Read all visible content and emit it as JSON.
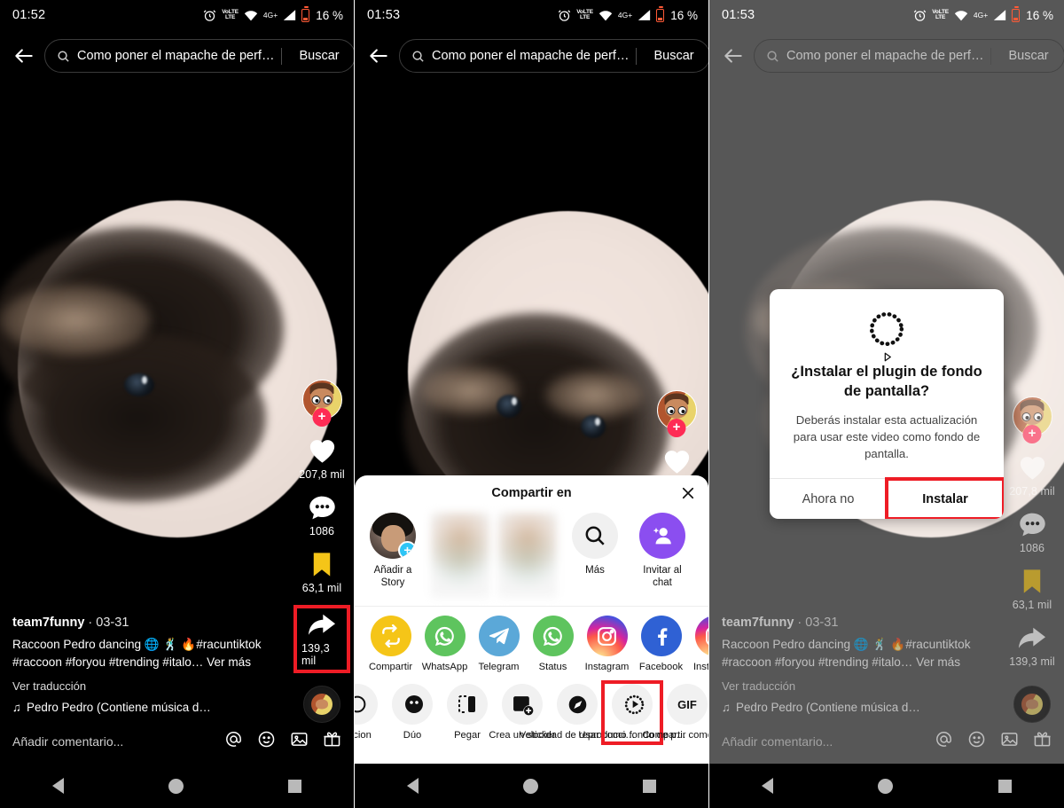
{
  "panels": [
    {
      "id": "panel-1",
      "status": {
        "clock": "01:52",
        "network": "4G+",
        "volte": "VoLTE",
        "battery": "16 %"
      },
      "search": {
        "query": "Como poner el mapache de perf…",
        "button": "Buscar",
        "back_icon": "arrow-left-icon",
        "search_icon": "search-icon"
      },
      "rail": {
        "likes": "207,8 mil",
        "comments": "1086",
        "favorites": "63,1 mil",
        "shares": "139,3 mil",
        "follow_badge": "+"
      },
      "caption": {
        "username": "team7funny",
        "separator": "·",
        "date": "03-31",
        "text": "Raccoon Pedro dancing 🌐 🕺 🔥#racuntiktok #raccoon #foryou #trending #italo…",
        "more": "Ver más",
        "translate": "Ver traducción",
        "music": "Pedro Pedro (Contiene música d…",
        "music_icon": "music-note-icon"
      },
      "comment_bar": {
        "placeholder": "Añadir comentario...",
        "icons": [
          "at-icon",
          "emoji-icon",
          "image-icon",
          "gift-icon"
        ]
      },
      "highlight": "share-button"
    },
    {
      "id": "panel-2",
      "status": {
        "clock": "01:53",
        "network": "4G+",
        "volte": "VoLTE",
        "battery": "16 %"
      },
      "search": {
        "query": "Como poner el mapache de perf…",
        "button": "Buscar",
        "back_icon": "arrow-left-icon",
        "search_icon": "search-icon"
      },
      "share_sheet": {
        "title": "Compartir en",
        "close_icon": "close-icon",
        "friends": [
          {
            "label": "Añadir a Story",
            "type": "story",
            "badge": "+"
          },
          {
            "label": "",
            "type": "blurred"
          },
          {
            "label": "",
            "type": "blurred"
          },
          {
            "label": "Más",
            "type": "more",
            "icon": "search-icon"
          },
          {
            "label": "Invitar al chat",
            "type": "invite",
            "icon": "person-add-icon"
          }
        ],
        "apps": [
          {
            "label": "Compartir",
            "icon": "repost-icon",
            "color": "#f5c518"
          },
          {
            "label": "WhatsApp",
            "icon": "whatsapp-icon",
            "color": "#5ec45e"
          },
          {
            "label": "Telegram",
            "icon": "telegram-icon",
            "color": "#5ba8d8"
          },
          {
            "label": "Status",
            "icon": "whatsapp-status-icon",
            "color": "#5ec45e"
          },
          {
            "label": "Instagram",
            "icon": "instagram-icon",
            "color": "#c13584"
          },
          {
            "label": "Facebook",
            "icon": "facebook-icon",
            "color": "#2f61d4"
          },
          {
            "label": "Insta Di…",
            "icon": "instagram-direct-icon",
            "color": "#c13584"
          }
        ],
        "actions": [
          {
            "label": "…cion",
            "icon": "reaction-icon"
          },
          {
            "label": "Dúo",
            "icon": "duet-icon"
          },
          {
            "label": "Pegar",
            "icon": "stitch-icon"
          },
          {
            "label": "Crea un sticker",
            "icon": "sticker-icon"
          },
          {
            "label": "Velocidad de reproducci…",
            "icon": "speed-icon"
          },
          {
            "label": "Usar como fondo de p…",
            "icon": "live-wallpaper-icon"
          },
          {
            "label": "Compartir como GIF",
            "icon": "gif-icon"
          }
        ],
        "highlight": "use-as-wallpaper-action"
      }
    },
    {
      "id": "panel-3",
      "status": {
        "clock": "01:53",
        "network": "4G+",
        "volte": "VoLTE",
        "battery": "16 %"
      },
      "search": {
        "query": "Como poner el mapache de perf…",
        "button": "Buscar",
        "back_icon": "arrow-left-icon",
        "search_icon": "search-icon"
      },
      "rail": {
        "likes": "207,8 mil",
        "comments": "1086",
        "favorites": "63,1 mil",
        "shares": "139,3 mil",
        "follow_badge": "+"
      },
      "caption": {
        "username": "team7funny",
        "separator": "·",
        "date": "03-31",
        "text": "Raccoon Pedro dancing 🌐 🕺 🔥#racuntiktok #raccoon #foryou #trending #italo…",
        "more": "Ver más",
        "translate": "Ver traducción",
        "music": "Pedro Pedro (Contiene música d…",
        "music_icon": "music-note-icon"
      },
      "comment_bar": {
        "placeholder": "Añadir comentario...",
        "icons": [
          "at-icon",
          "emoji-icon",
          "image-icon",
          "gift-icon"
        ]
      },
      "dialog": {
        "icon": "live-wallpaper-icon",
        "title": "¿Instalar el plugin de fondo de pantalla?",
        "message": "Deberás instalar esta actualización para usar este video como fondo de pantalla.",
        "cancel": "Ahora no",
        "confirm": "Instalar",
        "highlight": "install-button"
      }
    }
  ],
  "nav": {
    "back": "nav-back-icon",
    "home": "nav-home-icon",
    "recents": "nav-recents-icon"
  },
  "colors": {
    "highlight": "#ee1c25",
    "accent": "#fe2c55",
    "invite": "#8b4ef0",
    "bookmark": "#f5c518"
  }
}
